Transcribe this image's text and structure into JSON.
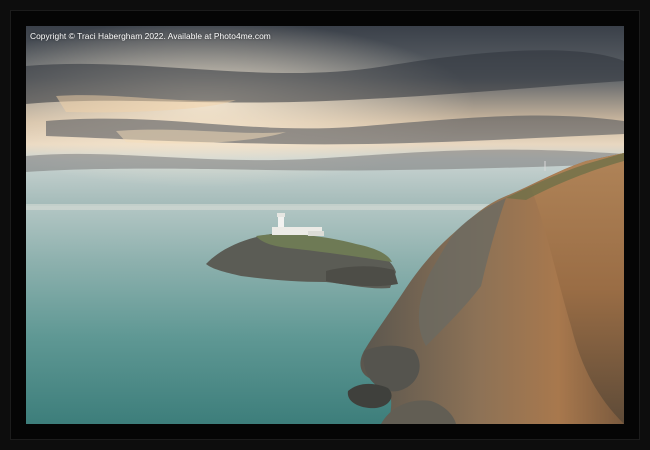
{
  "product": {
    "type": "framed-print",
    "frame_color": "#0d0d0d"
  },
  "photo": {
    "watermark": "Copyright © Traci Habergham 2022. Available at Photo4me.com",
    "subject": "lighthouse-on-sea-cliffs",
    "colors": {
      "sky_top": "#3f4650",
      "sky_glow": "#e9c9a2",
      "sea": "#4f8f8c",
      "cliff": "#8a6a4a"
    }
  }
}
